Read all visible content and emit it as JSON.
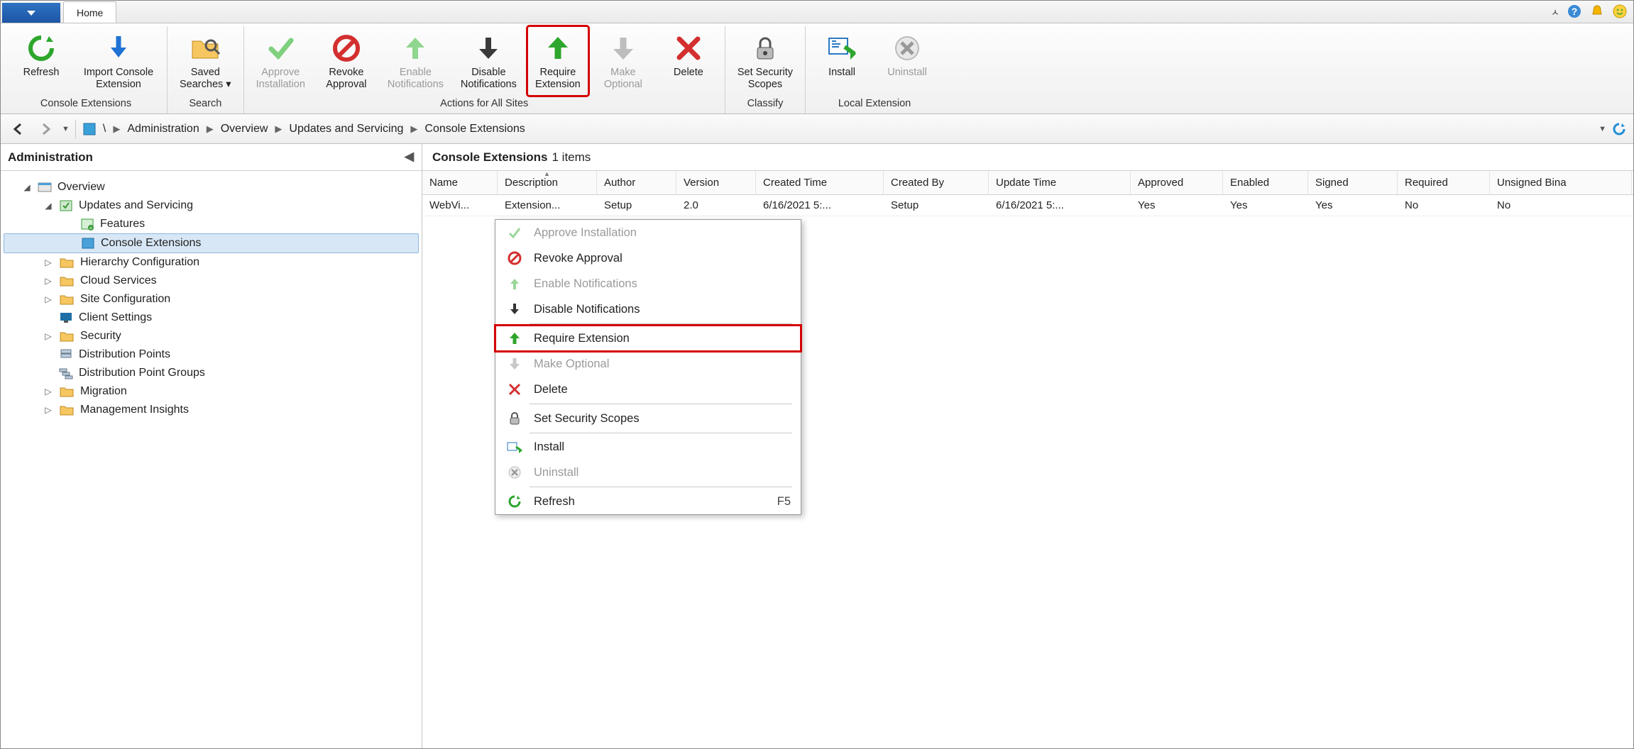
{
  "tabs": {
    "home": "Home"
  },
  "ribbon": {
    "groups": {
      "console_ext": {
        "label": "Console Extensions",
        "refresh": "Refresh",
        "import": "Import Console\nExtension"
      },
      "search": {
        "label": "Search",
        "saved": "Saved\nSearches ▾"
      },
      "actions": {
        "label": "Actions for All Sites",
        "approve": "Approve\nInstallation",
        "revoke": "Revoke\nApproval",
        "enable_notif": "Enable\nNotifications",
        "disable_notif": "Disable\nNotifications",
        "require": "Require\nExtension",
        "make_opt": "Make\nOptional",
        "delete": "Delete"
      },
      "classify": {
        "label": "Classify",
        "scopes": "Set Security\nScopes"
      },
      "local": {
        "label": "Local Extension",
        "install": "Install",
        "uninstall": "Uninstall"
      }
    }
  },
  "breadcrumb": {
    "root": "\\",
    "items": [
      "Administration",
      "Overview",
      "Updates and Servicing",
      "Console Extensions"
    ]
  },
  "tree": {
    "header": "Administration",
    "overview": "Overview",
    "updates": "Updates and Servicing",
    "features": "Features",
    "console_ext": "Console Extensions",
    "hierarchy": "Hierarchy Configuration",
    "cloud": "Cloud Services",
    "site": "Site Configuration",
    "client": "Client Settings",
    "security": "Security",
    "dist_points": "Distribution Points",
    "dist_groups": "Distribution Point Groups",
    "migration": "Migration",
    "insights": "Management Insights"
  },
  "list": {
    "title_bold": "Console Extensions",
    "title_count": "1 items",
    "columns": {
      "name": "Name",
      "desc": "Description",
      "author": "Author",
      "version": "Version",
      "created": "Created Time",
      "createdby": "Created By",
      "updated": "Update Time",
      "approved": "Approved",
      "enabled": "Enabled",
      "signed": "Signed",
      "required": "Required",
      "unsigned": "Unsigned Bina"
    },
    "row": {
      "name": "WebVi...",
      "desc": "Extension...",
      "author": "Setup",
      "version": "2.0",
      "created": "6/16/2021 5:...",
      "createdby": "Setup",
      "updated": "6/16/2021 5:...",
      "approved": "Yes",
      "enabled": "Yes",
      "signed": "Yes",
      "required": "No",
      "unsigned": "No"
    }
  },
  "menu": {
    "approve": "Approve Installation",
    "revoke": "Revoke Approval",
    "enable": "Enable Notifications",
    "disable": "Disable Notifications",
    "require": "Require Extension",
    "makeopt": "Make Optional",
    "delete": "Delete",
    "scopes": "Set Security Scopes",
    "install": "Install",
    "uninstall": "Uninstall",
    "refresh": "Refresh",
    "refresh_kb": "F5"
  }
}
